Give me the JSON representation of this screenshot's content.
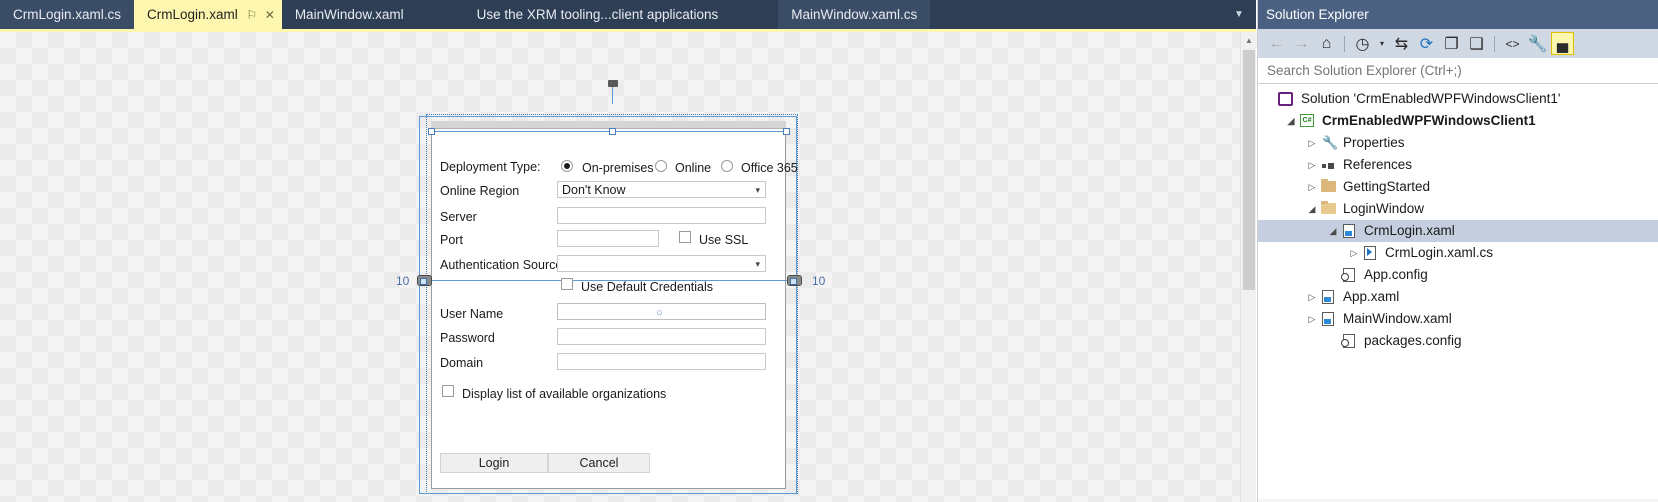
{
  "tabs": [
    {
      "label": "CrmLogin.xaml.cs",
      "state": "inactive"
    },
    {
      "label": "CrmLogin.xaml",
      "state": "active",
      "pin": "⚐",
      "close": "✕"
    },
    {
      "label": "MainWindow.xaml",
      "state": "plain"
    },
    {
      "label": "Use the XRM tooling...client applications",
      "state": "plain"
    },
    {
      "label": "MainWindow.xaml.cs",
      "state": "inactive"
    }
  ],
  "tab_dropdown_icon": "▼",
  "designer": {
    "margin_left_label": "10",
    "margin_right_label": "10",
    "form": {
      "deployment_type_label": "Deployment Type:",
      "radios": [
        {
          "label": "On-premises",
          "checked": true
        },
        {
          "label": "Online",
          "checked": false
        },
        {
          "label": "Office 365",
          "checked": false
        }
      ],
      "online_region_label": "Online Region",
      "online_region_value": "Don't Know",
      "server_label": "Server",
      "server_value": "",
      "port_label": "Port",
      "port_value": "",
      "use_ssl_label": "Use SSL",
      "auth_source_label": "Authentication Source:",
      "auth_source_value": "",
      "use_default_credentials_label": "Use Default Credentials",
      "user_name_label": "User Name",
      "user_name_value": "○",
      "password_label": "Password",
      "password_value": "",
      "domain_label": "Domain",
      "domain_value": "",
      "display_orgs_label": "Display list of available organizations",
      "login_button": "Login",
      "cancel_button": "Cancel"
    }
  },
  "solution_explorer": {
    "title": "Solution Explorer",
    "search_placeholder": "Search Solution Explorer (Ctrl+;)",
    "search_value": "",
    "toolbar": [
      {
        "name": "back-icon",
        "glyph": "←",
        "style": "disabled"
      },
      {
        "name": "forward-icon",
        "glyph": "→",
        "style": "disabled"
      },
      {
        "name": "home-icon",
        "glyph": "⌂",
        "style": ""
      },
      {
        "name": "separator",
        "glyph": "",
        "style": "sep"
      },
      {
        "name": "pending-changes-icon",
        "glyph": "◴",
        "style": ""
      },
      {
        "name": "chevron-down-icon",
        "glyph": "▾",
        "style": ""
      },
      {
        "name": "sync-views-icon",
        "glyph": "⇆",
        "style": ""
      },
      {
        "name": "refresh-icon",
        "glyph": "⟳",
        "style": "blue"
      },
      {
        "name": "collapse-all-icon",
        "glyph": "❐",
        "style": ""
      },
      {
        "name": "show-all-files-icon",
        "glyph": "❑",
        "style": ""
      },
      {
        "name": "separator",
        "glyph": "",
        "style": "sep"
      },
      {
        "name": "view-code-icon",
        "glyph": "‹›",
        "style": ""
      },
      {
        "name": "properties-icon",
        "glyph": "ὒ7",
        "style": "wrench"
      },
      {
        "name": "preview-tab-icon",
        "glyph": "▄",
        "style": "hl"
      }
    ],
    "tree": [
      {
        "label": "Solution 'CrmEnabledWPFWindowsClient1'",
        "indent": 0,
        "twisty": "",
        "icon": "solution-icon",
        "bold": false,
        "selected": false
      },
      {
        "label": "CrmEnabledWPFWindowsClient1",
        "indent": 1,
        "twisty": "◢",
        "icon": "csproj-icon",
        "bold": true,
        "selected": false
      },
      {
        "label": "Properties",
        "indent": 2,
        "twisty": "▷",
        "icon": "wrench-icon",
        "bold": false,
        "selected": false
      },
      {
        "label": "References",
        "indent": 2,
        "twisty": "▷",
        "icon": "references-icon",
        "bold": false,
        "selected": false
      },
      {
        "label": "GettingStarted",
        "indent": 2,
        "twisty": "▷",
        "icon": "folder-icon",
        "bold": false,
        "selected": false
      },
      {
        "label": "LoginWindow",
        "indent": 2,
        "twisty": "◢",
        "icon": "folder-open-icon",
        "bold": false,
        "selected": false
      },
      {
        "label": "CrmLogin.xaml",
        "indent": 3,
        "twisty": "◢",
        "icon": "xaml-icon",
        "bold": false,
        "selected": true
      },
      {
        "label": "CrmLogin.xaml.cs",
        "indent": 4,
        "twisty": "▷",
        "icon": "csfile-icon",
        "bold": false,
        "selected": false
      },
      {
        "label": "App.config",
        "indent": 3,
        "twisty": "",
        "icon": "config-icon",
        "bold": false,
        "selected": false
      },
      {
        "label": "App.xaml",
        "indent": 2,
        "twisty": "▷",
        "icon": "xaml-icon",
        "bold": false,
        "selected": false
      },
      {
        "label": "MainWindow.xaml",
        "indent": 2,
        "twisty": "▷",
        "icon": "xaml-icon",
        "bold": false,
        "selected": false
      },
      {
        "label": "packages.config",
        "indent": 3,
        "twisty": "",
        "icon": "config-icon",
        "bold": false,
        "selected": false
      }
    ]
  },
  "colors": {
    "tab_active_bg": "#fdf6ae",
    "tabstrip_bg": "#2d3e55",
    "se_title_bg": "#4a6181",
    "se_toolbar_bg": "#d0d8e4",
    "selection_blue": "#5b9bd5",
    "tree_selected_bg": "#c5cede"
  }
}
